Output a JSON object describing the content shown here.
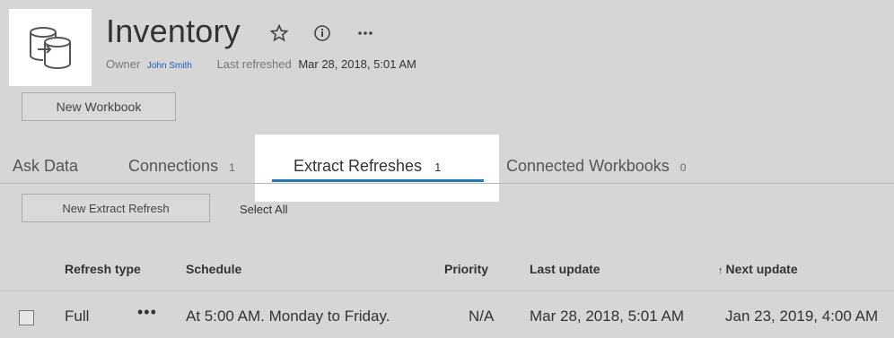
{
  "header": {
    "title": "Inventory",
    "owner_label": "Owner",
    "owner_name": "John Smith",
    "last_refreshed_label": "Last refreshed",
    "last_refreshed_value": "Mar 28, 2018, 5:01 AM",
    "actions": [
      "star-icon",
      "info-icon",
      "more-icon"
    ]
  },
  "buttons": {
    "new_workbook": "New Workbook",
    "new_extract_refresh": "New Extract Refresh",
    "select_all": "Select All"
  },
  "tabs": [
    {
      "label": "Ask Data",
      "count": ""
    },
    {
      "label": "Connections",
      "count": "1"
    },
    {
      "label": "Extract Refreshes",
      "count": "1",
      "active": true
    },
    {
      "label": "Connected Workbooks",
      "count": "0"
    }
  ],
  "table": {
    "columns": [
      "Refresh type",
      "Schedule",
      "Priority",
      "Last update",
      "Next update"
    ],
    "sorted_column": "Next update",
    "rows": [
      {
        "refresh_type": "Full",
        "menu": "•••",
        "schedule": "At 5:00 AM. Monday to Friday.",
        "priority": "N/A",
        "last_update": "Mar 28, 2018, 5:01 AM",
        "next_update": "Jan 23, 2019, 4:00 AM"
      }
    ]
  },
  "colors": {
    "background": "#d6d6d6",
    "highlight": "#ffffff",
    "accent": "#1f77b4",
    "link": "#1f5fbf"
  }
}
